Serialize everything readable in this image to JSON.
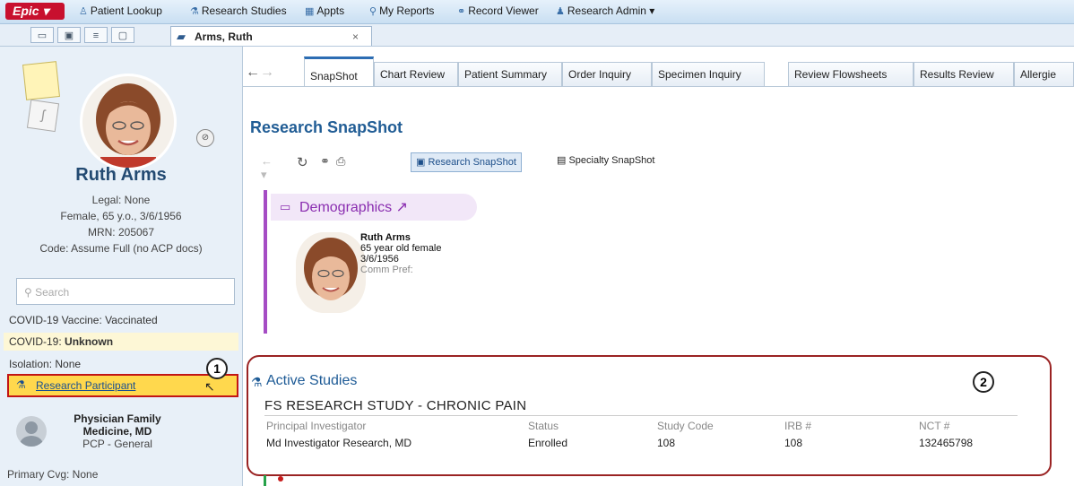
{
  "menubar": {
    "logo": "Epic ▾",
    "items": [
      {
        "label": "Patient Lookup",
        "icon": "person-icon"
      },
      {
        "label": "Research Studies",
        "icon": "research-icon"
      },
      {
        "label": "Appts",
        "icon": "calendar-icon"
      },
      {
        "label": "My Reports",
        "icon": "search-icon"
      },
      {
        "label": "Record Viewer",
        "icon": "binoculars-icon"
      },
      {
        "label": "Research Admin ▾",
        "icon": "admin-icon"
      }
    ]
  },
  "patient_tab": {
    "label": "Arms, Ruth",
    "close": "×"
  },
  "sidebar": {
    "name": "Ruth Arms",
    "legal": "Legal: None",
    "demographics": "Female, 65 y.o., 3/6/1956",
    "mrn": "MRN: 205067",
    "code": "Code: Assume Full (no ACP docs)",
    "search_placeholder": "Search",
    "covid_vaccine_label": "COVID-19 Vaccine:",
    "covid_vaccine_value": "Vaccinated",
    "covid_label": "COVID-19:",
    "covid_value": "Unknown",
    "isolation": "Isolation: None",
    "research_participant": "Research Participant",
    "badge1": "1",
    "pcp_name": "Physician Family Medicine, MD",
    "pcp_role": "PCP - General",
    "primary_cvg": "Primary Cvg: None"
  },
  "activity_tabs": [
    {
      "label": "SnapShot",
      "active": true
    },
    {
      "label": "Chart Review"
    },
    {
      "label": "Patient Summary"
    },
    {
      "label": "Order Inquiry"
    },
    {
      "label": "Specimen Inquiry"
    },
    {
      "label": "Review Flowsheets"
    },
    {
      "label": "Results Review"
    },
    {
      "label": "Allergie"
    }
  ],
  "main": {
    "title": "Research SnapShot",
    "research_snapshot_btn": "Research SnapShot",
    "specialty_snapshot_btn": "Specialty SnapShot"
  },
  "demographics": {
    "header": "Demographics",
    "name": "Ruth Arms",
    "age_sex": "65 year old female",
    "dob": "3/6/1956",
    "comm_pref": "Comm Pref:"
  },
  "active_studies": {
    "title": "Active Studies",
    "badge2": "2",
    "study_name": "FS RESEARCH STUDY - CHRONIC PAIN",
    "headers": [
      "Principal Investigator",
      "Status",
      "Study Code",
      "IRB #",
      "NCT #"
    ],
    "values": [
      "Md Investigator Research, MD",
      "Enrolled",
      "108",
      "108",
      "132465798"
    ]
  }
}
